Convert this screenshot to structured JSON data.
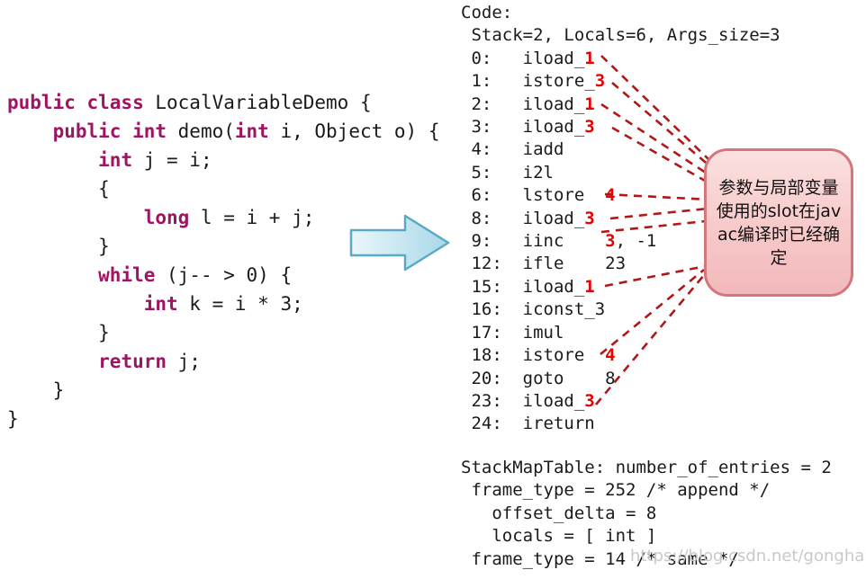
{
  "java_source": {
    "lines": [
      [
        {
          "t": "public class ",
          "k": true
        },
        {
          "t": "LocalVariableDemo {",
          "k": false
        }
      ],
      [
        {
          "t": "    ",
          "k": false
        },
        {
          "t": "public int ",
          "k": true
        },
        {
          "t": "demo(",
          "k": false
        },
        {
          "t": "int",
          "k": true
        },
        {
          "t": " i, Object o) {",
          "k": false
        }
      ],
      [
        {
          "t": "        ",
          "k": false
        },
        {
          "t": "int",
          "k": true
        },
        {
          "t": " j = i;",
          "k": false
        }
      ],
      [
        {
          "t": "        {",
          "k": false
        }
      ],
      [
        {
          "t": "            ",
          "k": false
        },
        {
          "t": "long",
          "k": true
        },
        {
          "t": " l = i + j;",
          "k": false
        }
      ],
      [
        {
          "t": "        }",
          "k": false
        }
      ],
      [
        {
          "t": "        ",
          "k": false
        },
        {
          "t": "while",
          "k": true
        },
        {
          "t": " (j-- > 0) {",
          "k": false
        }
      ],
      [
        {
          "t": "            ",
          "k": false
        },
        {
          "t": "int",
          "k": true
        },
        {
          "t": " k = i * 3;",
          "k": false
        }
      ],
      [
        {
          "t": "        }",
          "k": false
        }
      ],
      [
        {
          "t": "        ",
          "k": false
        },
        {
          "t": "return",
          "k": true
        },
        {
          "t": " j;",
          "k": false
        }
      ],
      [
        {
          "t": "    }",
          "k": false
        }
      ],
      [
        {
          "t": "}",
          "k": false
        }
      ]
    ]
  },
  "bytecode": {
    "header_label": "Code:",
    "summary_label": "Stack=2, Locals=6, Args_size=3",
    "instructions": [
      {
        "offset": "0:",
        "mnemonic": "iload_",
        "operand": "1",
        "operand_highlight": true
      },
      {
        "offset": "1:",
        "mnemonic": "istore_",
        "operand": "3",
        "operand_highlight": true
      },
      {
        "offset": "2:",
        "mnemonic": "iload_",
        "operand": "1",
        "operand_highlight": true
      },
      {
        "offset": "3:",
        "mnemonic": "iload_",
        "operand": "3",
        "operand_highlight": true
      },
      {
        "offset": "4:",
        "mnemonic": "iadd",
        "operand": "",
        "operand_highlight": false
      },
      {
        "offset": "5:",
        "mnemonic": "i2l",
        "operand": "",
        "operand_highlight": false
      },
      {
        "offset": "6:",
        "mnemonic": "lstore  ",
        "operand": "4",
        "operand_highlight": true
      },
      {
        "offset": "8:",
        "mnemonic": "iload_",
        "operand": "3",
        "operand_highlight": true
      },
      {
        "offset": "9:",
        "mnemonic": "iinc    ",
        "operand": "3",
        "operand_highlight": true,
        "suffix": ", -1"
      },
      {
        "offset": "12:",
        "mnemonic": "ifle    23",
        "operand": "",
        "operand_highlight": false
      },
      {
        "offset": "15:",
        "mnemonic": "iload_",
        "operand": "1",
        "operand_highlight": true
      },
      {
        "offset": "16:",
        "mnemonic": "iconst_3",
        "operand": "",
        "operand_highlight": false
      },
      {
        "offset": "17:",
        "mnemonic": "imul",
        "operand": "",
        "operand_highlight": false
      },
      {
        "offset": "18:",
        "mnemonic": "istore  ",
        "operand": "4",
        "operand_highlight": true
      },
      {
        "offset": "20:",
        "mnemonic": "goto    8",
        "operand": "",
        "operand_highlight": false
      },
      {
        "offset": "23:",
        "mnemonic": "iload_",
        "operand": "3",
        "operand_highlight": true
      },
      {
        "offset": "24:",
        "mnemonic": "ireturn",
        "operand": "",
        "operand_highlight": false
      }
    ]
  },
  "stackmap": {
    "lines": [
      "StackMapTable: number_of_entries = 2",
      " frame_type = 252 /* append */",
      "   offset_delta = 8",
      "   locals = [ int ]",
      " frame_type = 14 /* same */"
    ]
  },
  "annotation": {
    "text": "参数与局部变量使用的slot在javac编译时已经确定"
  },
  "watermark": {
    "text": "https://blog.csdn.net/gonghaiyu"
  },
  "colors": {
    "keyword": "#9c1462",
    "slot_highlight": "#e60000",
    "connector": "#b01818",
    "callout_fill": "#f7c9c9",
    "callout_border": "#d4767a",
    "arrow_fill": "#bfe3ef",
    "arrow_border": "#5ba9c4"
  }
}
